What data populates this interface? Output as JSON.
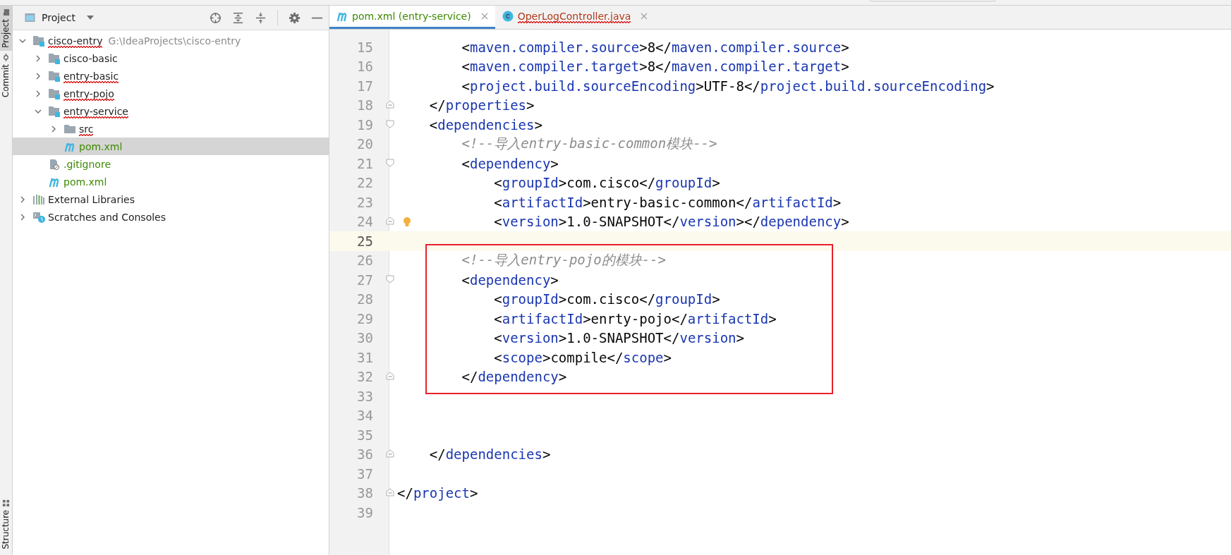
{
  "side_tabs_top": [
    {
      "label": "Project",
      "selected": true,
      "kind": "project"
    },
    {
      "label": "Commit",
      "selected": false,
      "kind": "commit"
    }
  ],
  "side_tabs_bottom": [
    {
      "label": "Structure",
      "selected": false,
      "kind": "structure"
    }
  ],
  "project_panel": {
    "title": "Project",
    "tree": [
      {
        "name": "cisco-entry",
        "path": "G:\\IdeaProjects\\cisco-entry",
        "kind": "module",
        "expanded": true,
        "selected": false,
        "vcs_added": false,
        "misspelled": true,
        "children": [
          {
            "name": "cisco-basic",
            "kind": "module",
            "expanded": false,
            "selected": false,
            "vcs_added": false,
            "misspelled": false
          },
          {
            "name": "entry-basic",
            "kind": "module",
            "expanded": false,
            "selected": false,
            "vcs_added": false,
            "misspelled": true
          },
          {
            "name": "entry-pojo",
            "kind": "module",
            "expanded": false,
            "selected": false,
            "vcs_added": false,
            "misspelled": true
          },
          {
            "name": "entry-service",
            "kind": "module",
            "expanded": true,
            "selected": false,
            "vcs_added": false,
            "misspelled": true,
            "children": [
              {
                "name": "src",
                "kind": "folder",
                "expanded": false,
                "selected": false,
                "vcs_added": false,
                "misspelled": true
              },
              {
                "name": "pom.xml",
                "kind": "maven",
                "selected": true,
                "vcs_added": true,
                "misspelled": false
              }
            ]
          },
          {
            "name": ".gitignore",
            "kind": "ignore",
            "selected": false,
            "vcs_added": true,
            "misspelled": false
          },
          {
            "name": "pom.xml",
            "kind": "maven",
            "selected": false,
            "vcs_added": true,
            "misspelled": false
          }
        ]
      },
      {
        "name": "External Libraries",
        "kind": "libraries",
        "expanded": false,
        "selected": false,
        "vcs_added": false,
        "misspelled": false
      },
      {
        "name": "Scratches and Consoles",
        "kind": "scratches",
        "expanded": false,
        "selected": false,
        "vcs_added": false,
        "misspelled": false
      }
    ]
  },
  "editor_tabs": [
    {
      "label": "pom.xml (entry-service)",
      "kind": "maven",
      "selected": true,
      "vcs_added": true,
      "misspelled": false
    },
    {
      "label": "OperLogController.java",
      "kind": "class",
      "selected": false,
      "vcs_added": false,
      "misspelled": true
    }
  ],
  "code_lines": [
    {
      "number": "15",
      "kind": "code",
      "text": "        <maven.compiler.source>8</maven.compiler.source>",
      "current": false
    },
    {
      "number": "16",
      "kind": "code",
      "text": "        <maven.compiler.target>8</maven.compiler.target>",
      "current": false
    },
    {
      "number": "17",
      "kind": "code",
      "text": "        <project.build.sourceEncoding>UTF-8</project.build.sourceEncoding>",
      "current": false
    },
    {
      "number": "18",
      "kind": "code",
      "text": "    </properties>",
      "fold": {
        "kind": "end"
      },
      "current": false
    },
    {
      "number": "19",
      "kind": "code",
      "text": "    <dependencies>",
      "fold": {
        "kind": "start"
      },
      "current": false
    },
    {
      "number": "20",
      "kind": "comment",
      "text": "        <!--导入entry-basic-common模块-->",
      "current": false
    },
    {
      "number": "21",
      "kind": "code",
      "text": "        <dependency>",
      "fold": {
        "kind": "start"
      },
      "current": false
    },
    {
      "number": "22",
      "kind": "code",
      "text": "            <groupId>com.cisco</groupId>",
      "current": false
    },
    {
      "number": "23",
      "kind": "code",
      "text": "            <artifactId>entry-basic-common</artifactId>",
      "current": false
    },
    {
      "number": "24",
      "kind": "code",
      "text": "            <version>1.0-SNAPSHOT</version></dependency>",
      "fold": {
        "kind": "end"
      },
      "hint": {
        "kind": "bulb"
      },
      "current": false
    },
    {
      "number": "25",
      "kind": "blank",
      "current": true
    },
    {
      "kind": "box",
      "lines": [
        {
          "number": "26",
          "kind": "comment",
          "text": "        <!--导入entry-pojo的模块-->",
          "current": false
        },
        {
          "number": "27",
          "kind": "code",
          "text": "        <dependency>",
          "fold": {
            "kind": "start"
          },
          "current": false
        },
        {
          "number": "28",
          "kind": "code",
          "text": "            <groupId>com.cisco</groupId>",
          "current": false
        },
        {
          "number": "29",
          "kind": "code",
          "text": "            <artifactId>enrty-pojo</artifactId>",
          "current": false
        },
        {
          "number": "30",
          "kind": "code",
          "text": "            <version>1.0-SNAPSHOT</version>",
          "current": false
        },
        {
          "number": "31",
          "kind": "code",
          "text": "            <scope>compile</scope>",
          "current": false
        },
        {
          "number": "32",
          "kind": "code",
          "text": "        </dependency>",
          "fold": {
            "kind": "end"
          },
          "current": false
        }
      ]
    },
    {
      "number": "33",
      "kind": "blank",
      "current": false
    },
    {
      "number": "34",
      "kind": "blank",
      "current": false
    },
    {
      "number": "35",
      "kind": "blank",
      "current": false
    },
    {
      "number": "36",
      "kind": "code",
      "text": "    </dependencies>",
      "fold": {
        "kind": "end"
      },
      "current": false
    },
    {
      "number": "37",
      "kind": "blank",
      "current": false
    },
    {
      "number": "38",
      "kind": "code",
      "text": "</project>",
      "fold": {
        "kind": "end"
      },
      "current": false
    },
    {
      "number": "39",
      "kind": "blank",
      "current": false
    }
  ]
}
